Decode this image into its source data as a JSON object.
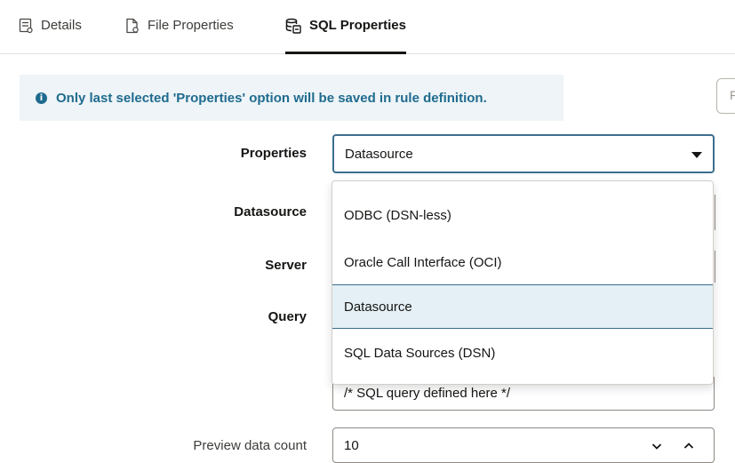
{
  "tabs": [
    {
      "label": "Details",
      "icon": "details-icon"
    },
    {
      "label": "File Properties",
      "icon": "file-properties-icon"
    },
    {
      "label": "SQL Properties",
      "icon": "database-icon",
      "active": true
    }
  ],
  "banner": {
    "icon": "info-icon",
    "text": "Only last selected 'Properties' option will be saved in rule definition."
  },
  "side_button": {
    "label": "F"
  },
  "form": {
    "properties": {
      "label": "Properties",
      "value": "Datasource"
    },
    "datasource": {
      "label": "Datasource"
    },
    "server": {
      "label": "Server"
    },
    "query": {
      "label": "Query",
      "value": "/* SQL query defined here */"
    },
    "preview": {
      "label": "Preview data count",
      "value": "10"
    }
  },
  "dropdown": {
    "options": [
      "ODBC (DSN-less)",
      "Oracle Call Interface (OCI)",
      "Datasource",
      "SQL Data Sources (DSN)"
    ],
    "selected": "Datasource"
  },
  "colors": {
    "accent": "#1f6b8f",
    "selection_bg": "#e4f0f5",
    "focus_border": "#3c6e8f"
  }
}
